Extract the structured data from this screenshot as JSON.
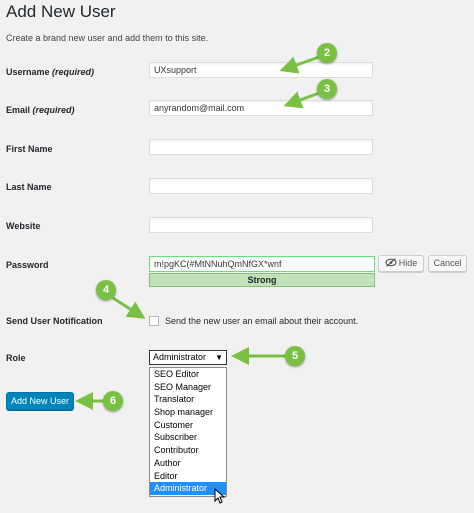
{
  "page": {
    "title": "Add New User",
    "description": "Create a brand new user and add them to this site."
  },
  "form": {
    "username": {
      "label": "Username",
      "required": "(required)",
      "value": "UXsupport"
    },
    "email": {
      "label": "Email",
      "required": "(required)",
      "value": "anyrandom@mail.com"
    },
    "first_name": {
      "label": "First Name",
      "value": ""
    },
    "last_name": {
      "label": "Last Name",
      "value": ""
    },
    "website": {
      "label": "Website",
      "value": ""
    },
    "password": {
      "label": "Password",
      "value": "m!pgKC(#MtNNuhQmNfGX*wnf",
      "strength": "Strong",
      "hide_label": "Hide",
      "cancel_label": "Cancel"
    },
    "notification": {
      "label": "Send User Notification",
      "checkbox_label": "Send the new user an email about their account.",
      "checked": false
    },
    "role": {
      "label": "Role",
      "selected": "Administrator",
      "options": [
        "SEO Editor",
        "SEO Manager",
        "Translator",
        "Shop manager",
        "Customer",
        "Subscriber",
        "Contributor",
        "Author",
        "Editor",
        "Administrator"
      ]
    },
    "submit_label": "Add New User"
  },
  "annotations": {
    "color": "#7ac143",
    "badges": [
      "2",
      "3",
      "4",
      "5",
      "6"
    ]
  }
}
